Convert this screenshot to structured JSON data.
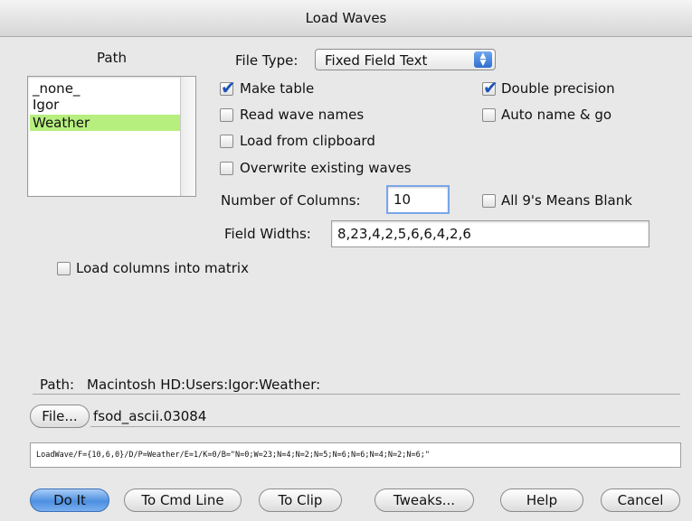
{
  "window": {
    "title": "Load Waves"
  },
  "path_panel": {
    "label": "Path",
    "items": [
      {
        "label": "_none_",
        "selected": false
      },
      {
        "label": "Igor",
        "selected": false
      },
      {
        "label": "Weather",
        "selected": true
      }
    ]
  },
  "file_type": {
    "label": "File Type:",
    "value": "Fixed Field Text"
  },
  "checkboxes": {
    "make_table": {
      "label": "Make table",
      "checked": true
    },
    "read_wave_names": {
      "label": "Read wave names",
      "checked": false
    },
    "load_from_clipboard": {
      "label": "Load from clipboard",
      "checked": false
    },
    "overwrite_existing": {
      "label": "Overwrite existing waves",
      "checked": false
    },
    "double_precision": {
      "label": "Double precision",
      "checked": true
    },
    "auto_name_go": {
      "label": "Auto name & go",
      "checked": false
    },
    "all_nines_blank": {
      "label": "All 9's Means Blank",
      "checked": false
    },
    "load_columns_matrix": {
      "label": "Load columns into matrix",
      "checked": false
    }
  },
  "num_columns": {
    "label": "Number of Columns:",
    "value": "10"
  },
  "field_widths": {
    "label": "Field Widths:",
    "value": "8,23,4,2,5,6,6,4,2,6"
  },
  "path_info": {
    "label": "Path:",
    "value": "Macintosh HD:Users:Igor:Weather:"
  },
  "file": {
    "button_label": "File...",
    "name": "fsod_ascii.03084"
  },
  "command_line": "LoadWave/F={10,6,0}/D/P=Weather/E=1/K=0/B=\"N=0;W=23;N=4;N=2;N=5;N=6;N=6;N=4;N=2;N=6;\"",
  "buttons": {
    "do_it": "Do It",
    "to_cmd_line": "To Cmd Line",
    "to_clip": "To Clip",
    "tweaks": "Tweaks...",
    "help": "Help",
    "cancel": "Cancel"
  },
  "colors": {
    "selection": "#b7ef7f",
    "accent": "#2f6fd0"
  }
}
